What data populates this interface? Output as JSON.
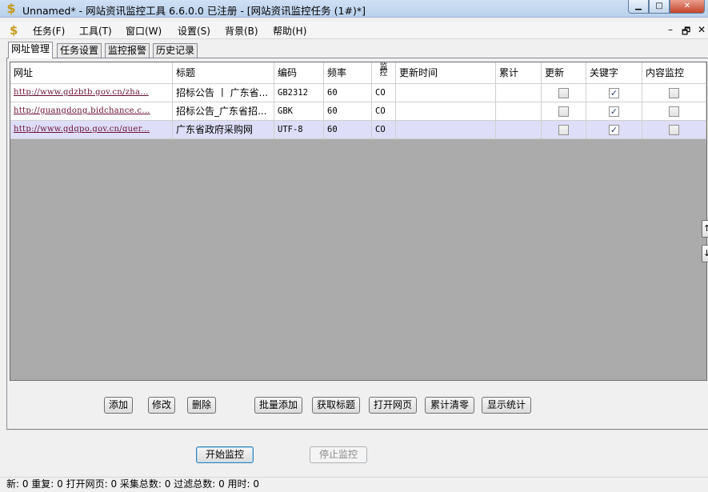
{
  "window": {
    "title": "Unnamed* - 网站资讯监控工具 6.6.0.0  已注册 - [网站资讯监控任务  (1#)*]",
    "icon": "dollar-icon",
    "minimize": "▁",
    "maximize": "□",
    "close": "✕"
  },
  "menu": {
    "items": [
      "任务(F)",
      "工具(T)",
      "窗口(W)",
      "设置(S)",
      "背景(B)",
      "帮助(H)"
    ],
    "mdi_minimize": "–",
    "mdi_restore": "🗗",
    "mdi_close": "✕"
  },
  "tabs": [
    "网址管理",
    "任务设置",
    "监控报警",
    "历史记录"
  ],
  "grid": {
    "columns": [
      "网址",
      "标题",
      "编码",
      "频率",
      "监控",
      "更新时间",
      "累计",
      "更新",
      "关键字",
      "内容监控"
    ],
    "rows": [
      {
        "url": "http://www.gdzbtb.gov.cn/zha...",
        "title": "招标公告 丨 广东省...",
        "encoding": "GB2312",
        "freq": "60",
        "monitor": "CO",
        "update_time": "",
        "total": "",
        "update": false,
        "keyword": true,
        "content": false
      },
      {
        "url": "http://guangdong.bidchance.c...",
        "title": "招标公告_广东省招...",
        "encoding": "GBK",
        "freq": "60",
        "monitor": "CO",
        "update_time": "",
        "total": "",
        "update": false,
        "keyword": true,
        "content": false
      },
      {
        "url": "http://www.gdgpo.gov.cn/quer...",
        "title": "广东省政府采购网",
        "encoding": "UTF-8",
        "freq": "60",
        "monitor": "CO",
        "update_time": "",
        "total": "",
        "update": false,
        "keyword": true,
        "content": false
      }
    ],
    "selected_row": 2,
    "move_up": "↑",
    "move_down": "↓"
  },
  "buttons": {
    "add": "添加",
    "edit": "修改",
    "delete": "删除",
    "batch_add": "批量添加",
    "fetch_title": "获取标题",
    "open_page": "打开网页",
    "clear_total": "累计清零",
    "show_stats": "显示统计",
    "start": "开始监控",
    "stop": "停止监控"
  },
  "status": "新:  0   重复:  0   打开网页:  0   采集总数:  0   过滤总数:  0   用时:  0"
}
